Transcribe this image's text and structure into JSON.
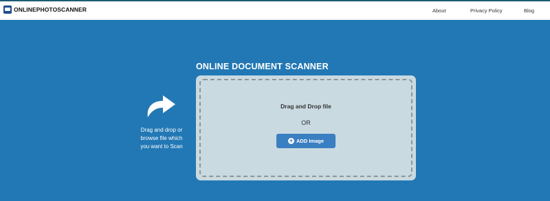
{
  "brand": {
    "name": "ONLINEPHOTOSCANNER",
    "icon": "scanner-logo-icon"
  },
  "nav": {
    "items": [
      "About",
      "Privacy Policy",
      "Blog"
    ]
  },
  "main": {
    "heading": "ONLINE DOCUMENT SCANNER",
    "side_text": "Drag and drop or browse file which you want to Scan",
    "arrow_icon": "share-arrow-icon",
    "dropzone": {
      "title": "Drag and Drop file",
      "or": "OR",
      "button_label": "ADD Image",
      "button_icon": "plus-circle-icon"
    }
  },
  "colors": {
    "background": "#2278b4",
    "dropzone": "#c9dae1",
    "button": "#3a7fc1",
    "navbar": "#ffffff"
  }
}
